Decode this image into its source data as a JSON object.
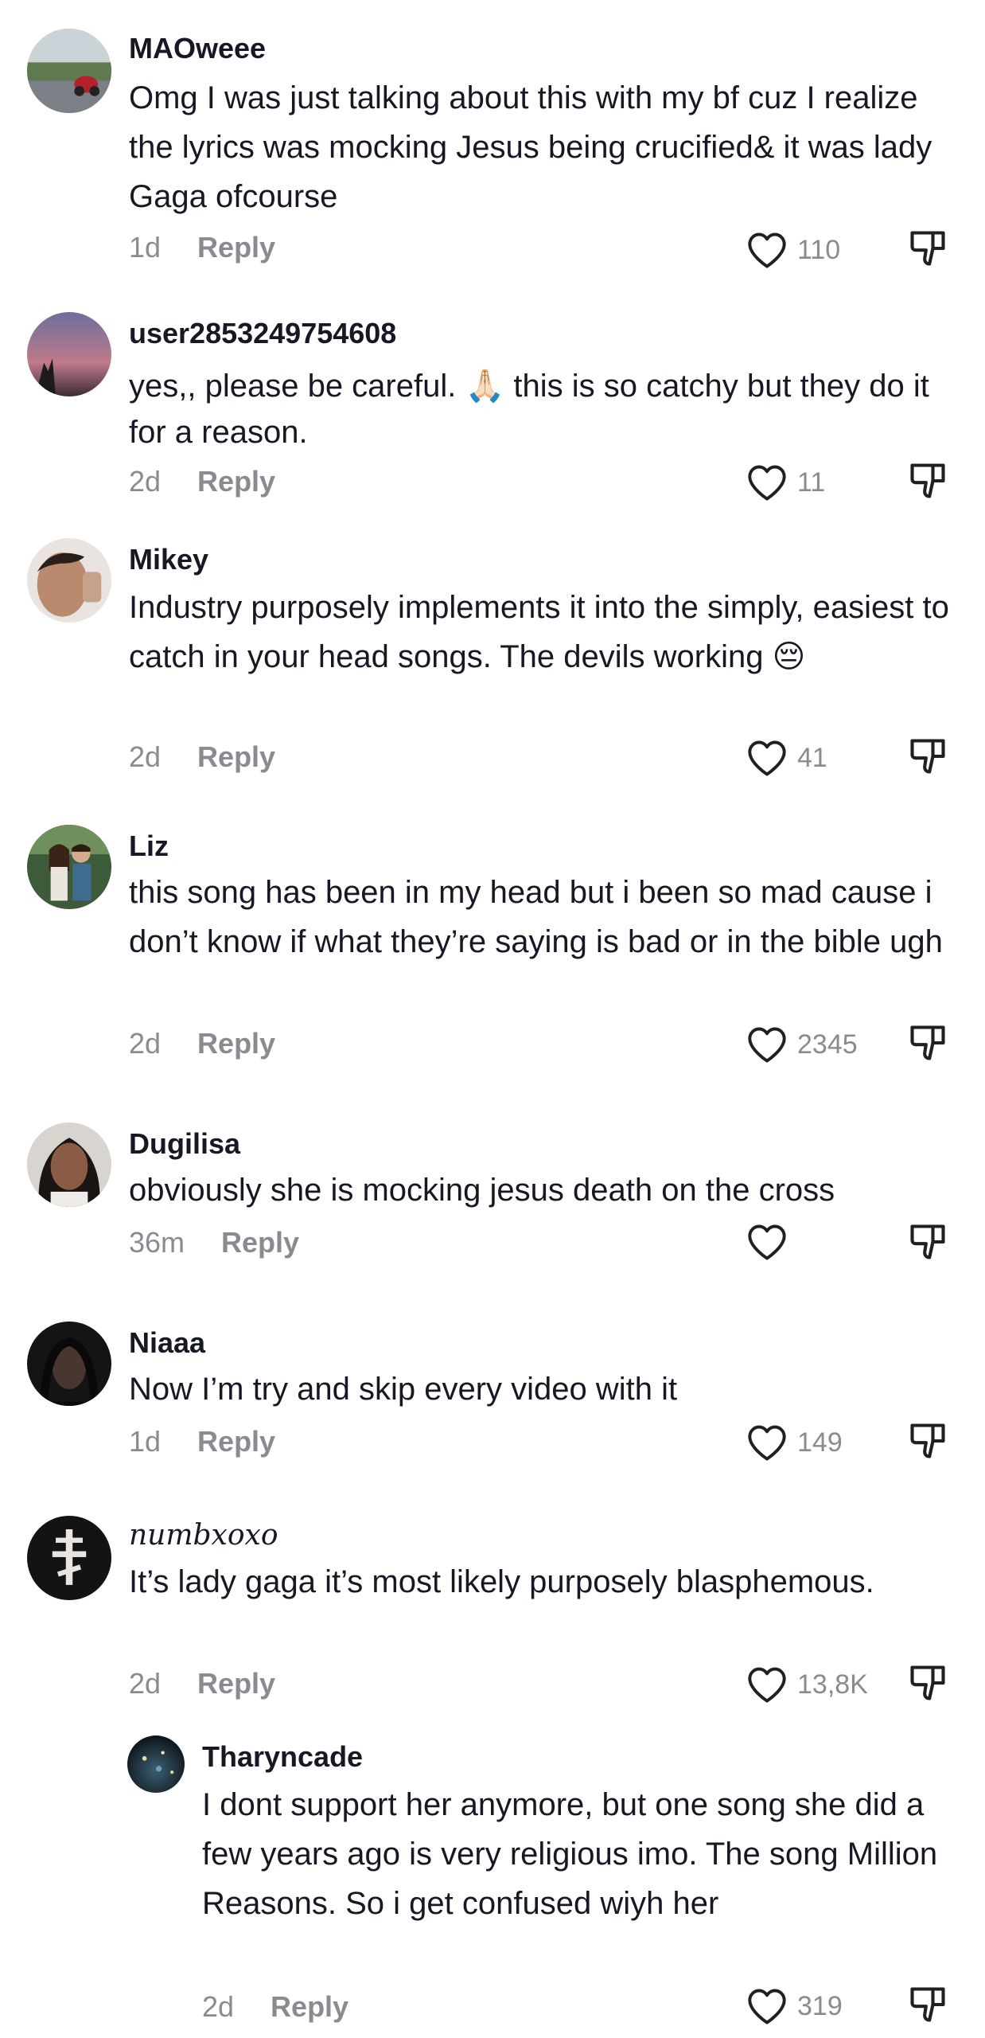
{
  "comments": [
    {
      "username": "MAOweee",
      "text": "Omg I was just talking about this with my bf cuz I realize the lyrics was mocking Jesus being crucified& it was lady Gaga ofcourse",
      "time": "1d",
      "reply_label": "Reply",
      "likes": "110"
    },
    {
      "username": "user2853249754608",
      "text_before_emoji": "yes,, please be careful. ",
      "emoji": "🙏🏻",
      "text_after_emoji": " this is so catchy but they do it for a reason.",
      "time": "2d",
      "reply_label": "Reply",
      "likes": "11"
    },
    {
      "username": "Mikey",
      "text_before_emoji": "Industry purposely implements it into the simply, easiest to catch in your head songs. The devils working ",
      "emoji": "😔",
      "time": "2d",
      "reply_label": "Reply",
      "likes": "41"
    },
    {
      "username": "Liz",
      "text": "this song has been in my head but i been so mad cause i don’t know if what they’re saying is bad or in the bible ugh",
      "time": "2d",
      "reply_label": "Reply",
      "likes": "2345"
    },
    {
      "username": "Dugilisa",
      "text": "obviously she is mocking jesus death on the cross",
      "time": "36m",
      "reply_label": "Reply",
      "likes": ""
    },
    {
      "username": "Niaaa",
      "text": "Now I’m try and skip every video with it",
      "time": "1d",
      "reply_label": "Reply",
      "likes": "149"
    },
    {
      "username": "numbxoxo",
      "text": "It’s lady gaga it’s most likely purposely blasphemous.",
      "time": "2d",
      "reply_label": "Reply",
      "likes": "13,8K"
    }
  ],
  "reply": {
    "username": "Tharyncade",
    "text": "I dont support her anymore, but one song she did a few years ago is very religious imo. The song Million Reasons. So i get confused wiyh her",
    "time": "2d",
    "reply_label": "Reply",
    "likes": "319"
  },
  "icons": {
    "like": "heart-outline-icon",
    "dislike": "thumbs-down-icon"
  },
  "colors": {
    "text": "#161823",
    "meta": "#8a8b91",
    "background": "#ffffff"
  }
}
